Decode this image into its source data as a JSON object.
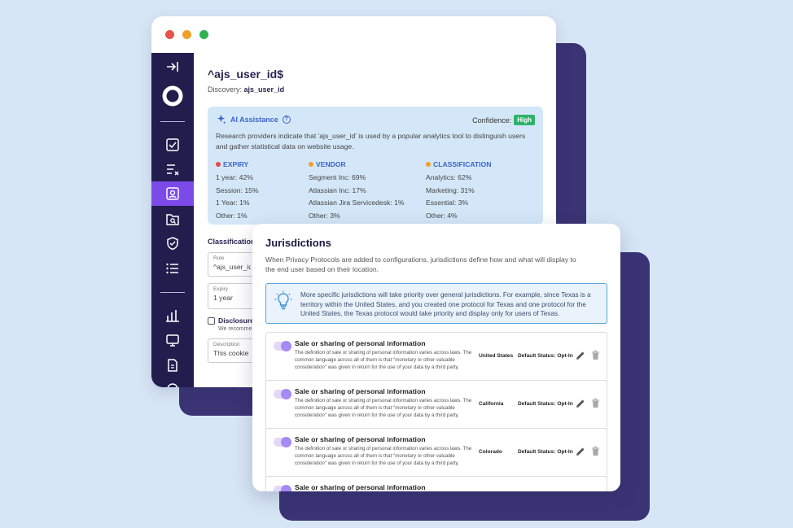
{
  "detail": {
    "cookie_name": "^ajs_user_id$",
    "discovery_label": "Discovery:",
    "discovery_value": "ajs_user_id",
    "ai": {
      "label": "AI Assistance",
      "confidence_label": "Confidence:",
      "confidence_value": "High",
      "description": "Research providers indicate that 'ajs_user_id' is used by a popular analytics tool to distinguish users and gather statistical data on website usage.",
      "columns": [
        {
          "title": "EXPIRY",
          "color": "#e5484d",
          "items": [
            "1 year: 42%",
            "Session: 15%",
            "1 Year: 1%",
            "Other: 1%"
          ]
        },
        {
          "title": "VENDOR",
          "color": "#f0a029",
          "items": [
            "Segment Inc: 69%",
            "Atlassian Inc: 17%",
            "Atlassian Jira Servicedesk: 1%",
            "Other: 3%"
          ]
        },
        {
          "title": "CLASSIFICATION",
          "color": "#f0a029",
          "items": [
            "Analytics: 62%",
            "Marketing: 31%",
            "Essential: 3%",
            "Other: 4%"
          ]
        }
      ]
    },
    "classification_label": "Classification",
    "rule_label": "Rule",
    "rule_value": "^ajs_user_id$",
    "expiry_label": "Expiry",
    "expiry_value": "1 year",
    "disclosure_label": "Disclosure",
    "disclosure_sub": "We recommend",
    "description_label": "Description",
    "description_value": "This cookie"
  },
  "jurisdictions": {
    "title": "Jurisdictions",
    "description": "When Privacy Protocols are added to configurations, jurisdictions define how and what will display to the end user based on their location.",
    "tip": "More specific jurisdictions will take priority over general jurisdictions. For example, since Texas is a territory within the United States, and you created one protocol for Texas and one protocol for the United States, the Texas protocol would take priority and display only for users of Texas.",
    "rows": [
      {
        "title": "Sale or sharing of personal information",
        "desc": "The definition of sale or sharing of personal information varies across laws. The common language across all of them is that \"monetary or other valuable consideration\" was given in return for the use of your data by a third party.",
        "location": "United States",
        "status": "Default Status: Opt-In"
      },
      {
        "title": "Sale or sharing of personal information",
        "desc": "The definition of sale or sharing of personal information varies across laws. The common language across all of them is that \"monetary or other valuable consideration\" was given in return for the use of your data by a third party.",
        "location": "California",
        "status": "Default Status: Opt-In"
      },
      {
        "title": "Sale or sharing of personal information",
        "desc": "The definition of sale or sharing of personal information varies across laws. The common language across all of them is that \"monetary or other valuable consideration\" was given in return for the use of your data by a third party.",
        "location": "Colorado",
        "status": "Default Status: Opt-In"
      },
      {
        "title": "Sale or sharing of personal information",
        "desc": "",
        "location": "",
        "status": ""
      }
    ]
  }
}
